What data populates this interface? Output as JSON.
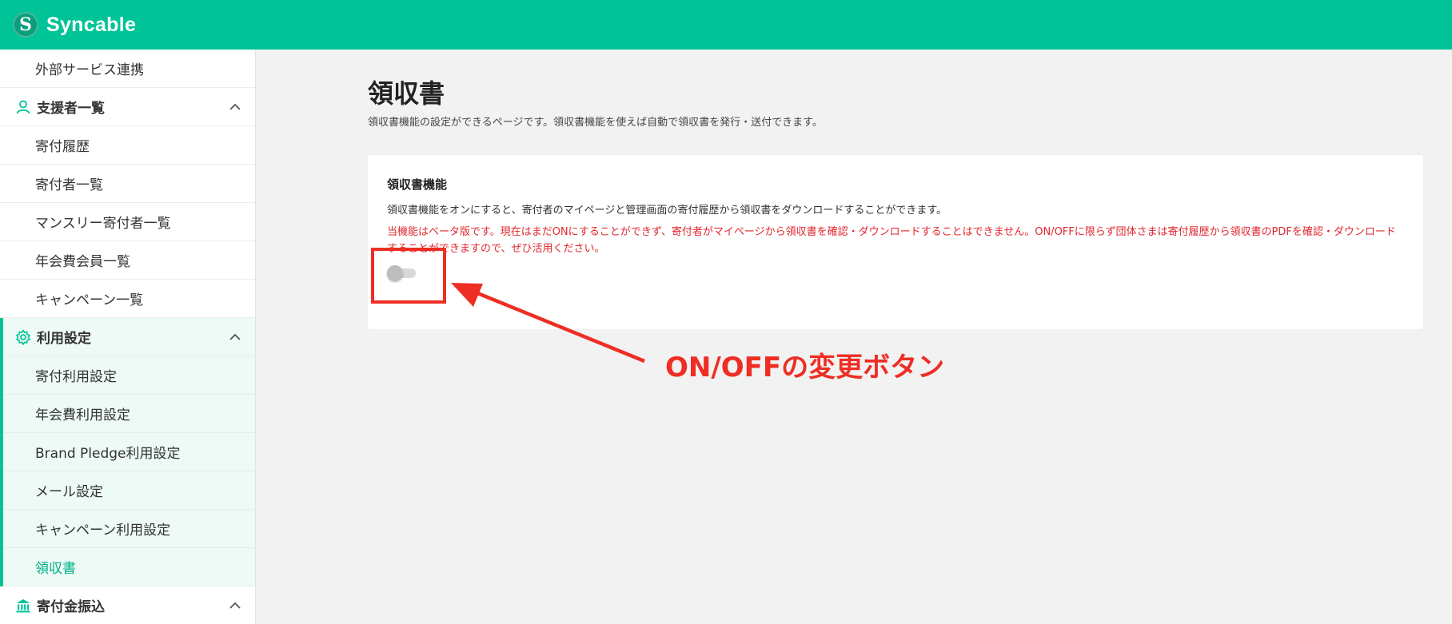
{
  "app": {
    "logo_letter": "S",
    "name": "Syncable"
  },
  "sidebar": {
    "top_items": [
      "外部サービス連携"
    ],
    "sections": [
      {
        "label": "支援者一覧",
        "icon": "person-icon",
        "items": [
          "寄付履歴",
          "寄付者一覧",
          "マンスリー寄付者一覧",
          "年会費会員一覧",
          "キャンペーン一覧"
        ]
      },
      {
        "label": "利用設定",
        "icon": "gear-icon",
        "items": [
          "寄付利用設定",
          "年会費利用設定",
          "Brand Pledge利用設定",
          "メール設定",
          "キャンペーン利用設定",
          "領収書"
        ],
        "current": "領収書"
      },
      {
        "label": "寄付金振込",
        "icon": "bank-icon",
        "items": []
      }
    ]
  },
  "page": {
    "title": "領収書",
    "description": "領収書機能の設定ができるページです。領収書機能を使えば自動で領収書を発行・送付できます。"
  },
  "card": {
    "title": "領収書機能",
    "description": "領収書機能をオンにすると、寄付者のマイページと管理画面の寄付履歴から領収書をダウンロードすることができます。",
    "warning": "当機能はベータ版です。現在はまだONにすることができず、寄付者がマイページから領収書を確認・ダウンロードすることはできません。ON/OFFに限らず団体さまは寄付履歴から領収書のPDFを確認・ダウンロードすることができますので、ぜひ活用ください。",
    "toggle_on": false
  },
  "annotation": {
    "label": "ON/OFFの変更ボタン",
    "color": "#ee2e24"
  },
  "colors": {
    "brand": "#00c497",
    "warning": "#e0272e"
  }
}
